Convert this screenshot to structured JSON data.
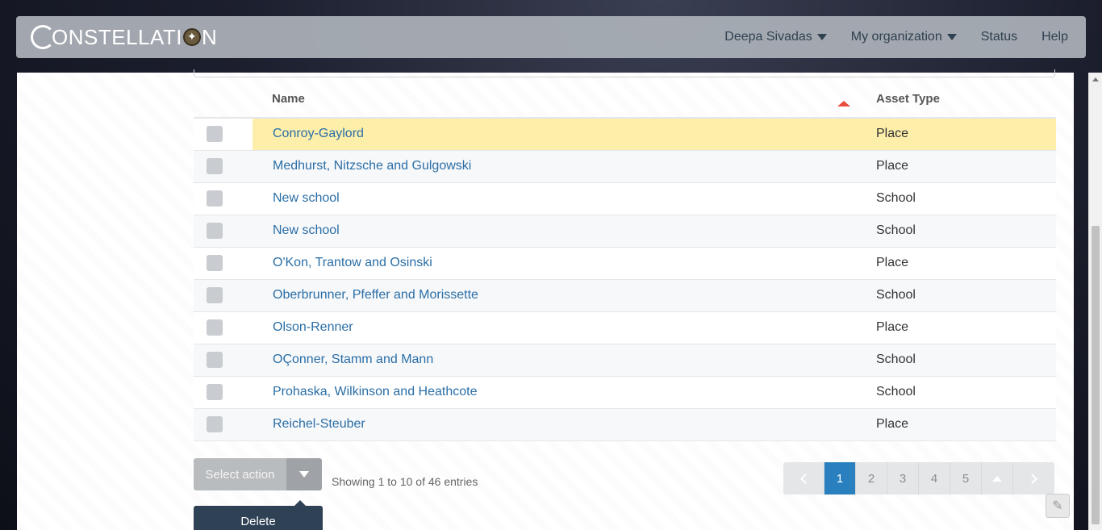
{
  "brand": {
    "logo_text": "ONSTELLATI",
    "logo_end": "N"
  },
  "nav": {
    "user": "Deepa Sivadas",
    "org": "My organization",
    "status": "Status",
    "help": "Help"
  },
  "table": {
    "headers": {
      "name": "Name",
      "asset_type": "Asset Type"
    },
    "sort": {
      "column": "Asset Type",
      "direction": "ascending"
    },
    "rows": [
      {
        "name": "Conroy-Gaylord",
        "type": "Place"
      },
      {
        "name": "Medhurst, Nitzsche and Gulgowski",
        "type": "Place"
      },
      {
        "name": "New school",
        "type": "School"
      },
      {
        "name": "New school",
        "type": "School"
      },
      {
        "name": "O'Kon, Trantow and Osinski",
        "type": "Place"
      },
      {
        "name": "Oberbrunner, Pfeffer and Morissette",
        "type": "School"
      },
      {
        "name": "Olson-Renner",
        "type": "Place"
      },
      {
        "name": "OÇonner, Stamm and Mann",
        "type": "School"
      },
      {
        "name": "Prohaska, Wilkinson and Heathcote",
        "type": "School"
      },
      {
        "name": "Reichel-Steuber",
        "type": "Place"
      }
    ]
  },
  "actions": {
    "select_label": "Select action",
    "dropdown_item": "Delete"
  },
  "info": "Showing 1 to 10 of 46 entries",
  "pagination": {
    "pages": [
      "1",
      "2",
      "3",
      "4",
      "5"
    ],
    "current": "1"
  },
  "colors": {
    "link": "#2a6ea6",
    "highlight_row": "#fdeeaa",
    "active_page": "#2a7fbf",
    "sort_arrow": "#e74c3c",
    "dropdown_bg": "#2f4155"
  },
  "icons": [
    "caret-down-icon",
    "sort-asc-icon",
    "chevron-left-icon",
    "chevron-right-icon",
    "chevron-up-icon",
    "help-widget-icon"
  ]
}
